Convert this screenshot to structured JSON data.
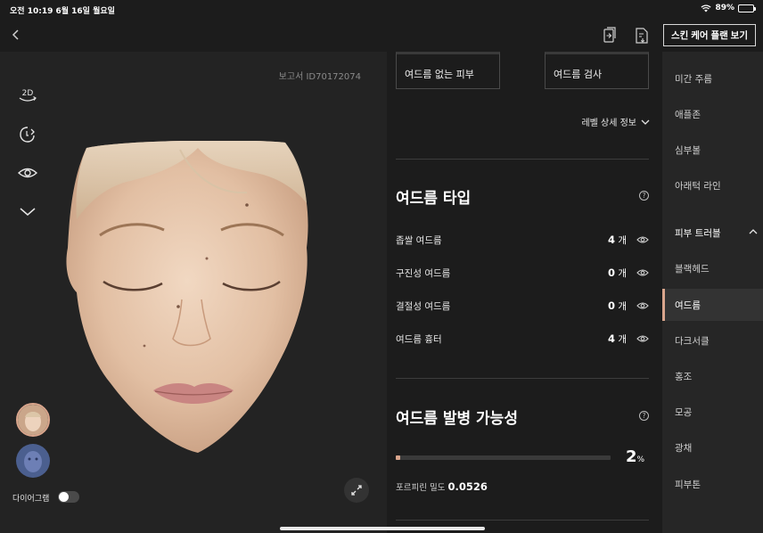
{
  "status": {
    "time": "오전 10:19  6월 16일 월요일",
    "battery": "89%",
    "battery_level": 0.89
  },
  "topbar": {
    "back_icon": "chevron-left-icon",
    "icon1": "compare-report-icon",
    "icon2": "export-report-icon",
    "plan_button": "스킨 케어 플랜 보기"
  },
  "left": {
    "report_id": "보고서 ID70172074",
    "tools": [
      {
        "name": "2d-view-icon",
        "label": "2D"
      },
      {
        "name": "rotate-face-icon"
      },
      {
        "name": "eye-view-icon"
      },
      {
        "name": "chevron-down-icon"
      }
    ],
    "diagram_label": "다이어그램",
    "diagram_toggle_on": false
  },
  "tabs": {
    "first": "여드름 없는 피부",
    "second": "여드름 검사"
  },
  "level_link": "레벨 상세 정보",
  "acne_type": {
    "title": "여드름 타입",
    "help": "?",
    "rows": [
      {
        "label": "좁쌀 여드름",
        "count": "4",
        "unit": "개"
      },
      {
        "label": "구진성 여드름",
        "count": "0",
        "unit": "개"
      },
      {
        "label": "결절성 여드름",
        "count": "0",
        "unit": "개"
      },
      {
        "label": "여드름 흉터",
        "count": "4",
        "unit": "개"
      }
    ]
  },
  "likelihood": {
    "title": "여드름 발병 가능성",
    "help": "?",
    "percent": "2",
    "percent_value": 2,
    "percent_unit": "%",
    "porphyrin_label": "포르피린 밀도",
    "porphyrin_value": "0.0526"
  },
  "sidebar": {
    "items": [
      {
        "label": "미간 주름"
      },
      {
        "label": "애플존"
      },
      {
        "label": "심부볼"
      },
      {
        "label": "아래턱 라인"
      },
      {
        "label": "피부 트러블",
        "header": true
      },
      {
        "label": "블랙헤드"
      },
      {
        "label": "여드름",
        "active": true
      },
      {
        "label": "다크서클"
      },
      {
        "label": "홍조"
      },
      {
        "label": "모공"
      },
      {
        "label": "광채"
      },
      {
        "label": "피부톤"
      }
    ]
  },
  "colors": {
    "accent": "#d9a58c",
    "background": "#1c1c1c",
    "panel": "#232323",
    "sidebar": "#262626"
  }
}
